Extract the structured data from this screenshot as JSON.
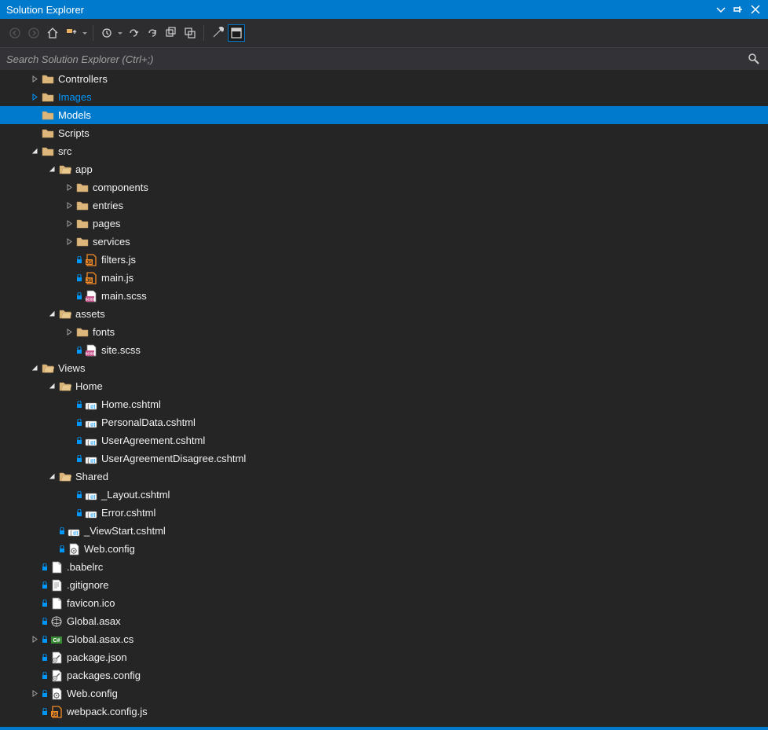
{
  "title": "Solution Explorer",
  "search": {
    "placeholder": "Search Solution Explorer (Ctrl+;)"
  },
  "toolbar": {
    "back": "back",
    "forward": "forward",
    "home": "home",
    "sync": "sync",
    "pending": "pending",
    "undo": "undo",
    "refresh": "refresh",
    "collapse": "collapse-all",
    "showall": "show-all",
    "properties": "properties",
    "preview": "preview"
  },
  "tree": [
    {
      "depth": 1,
      "arrow": "closed",
      "icon": "folder",
      "label": "Controllers"
    },
    {
      "depth": 1,
      "arrow": "closed",
      "icon": "folder",
      "label": "Images",
      "active": true
    },
    {
      "depth": 1,
      "arrow": "none",
      "icon": "folder",
      "label": "Models",
      "selected": true
    },
    {
      "depth": 1,
      "arrow": "none",
      "icon": "folder",
      "label": "Scripts"
    },
    {
      "depth": 1,
      "arrow": "open",
      "icon": "folder",
      "label": "src"
    },
    {
      "depth": 2,
      "arrow": "open",
      "icon": "folder-o",
      "label": "app"
    },
    {
      "depth": 3,
      "arrow": "closed",
      "icon": "folder",
      "label": "components"
    },
    {
      "depth": 3,
      "arrow": "closed",
      "icon": "folder",
      "label": "entries"
    },
    {
      "depth": 3,
      "arrow": "closed",
      "icon": "folder",
      "label": "pages"
    },
    {
      "depth": 3,
      "arrow": "closed",
      "icon": "folder",
      "label": "services"
    },
    {
      "depth": 3,
      "arrow": "none",
      "icon": "js",
      "label": "filters.js",
      "lock": true
    },
    {
      "depth": 3,
      "arrow": "none",
      "icon": "js",
      "label": "main.js",
      "lock": true
    },
    {
      "depth": 3,
      "arrow": "none",
      "icon": "scss",
      "label": "main.scss",
      "lock": true
    },
    {
      "depth": 2,
      "arrow": "open",
      "icon": "folder-o",
      "label": "assets"
    },
    {
      "depth": 3,
      "arrow": "closed",
      "icon": "folder",
      "label": "fonts"
    },
    {
      "depth": 3,
      "arrow": "none",
      "icon": "scss",
      "label": "site.scss",
      "lock": true
    },
    {
      "depth": 1,
      "arrow": "open",
      "icon": "folder-o",
      "label": "Views"
    },
    {
      "depth": 2,
      "arrow": "open",
      "icon": "folder-o",
      "label": "Home"
    },
    {
      "depth": 3,
      "arrow": "none",
      "icon": "cshtml",
      "label": "Home.cshtml",
      "lock": true
    },
    {
      "depth": 3,
      "arrow": "none",
      "icon": "cshtml",
      "label": "PersonalData.cshtml",
      "lock": true
    },
    {
      "depth": 3,
      "arrow": "none",
      "icon": "cshtml",
      "label": "UserAgreement.cshtml",
      "lock": true
    },
    {
      "depth": 3,
      "arrow": "none",
      "icon": "cshtml",
      "label": "UserAgreementDisagree.cshtml",
      "lock": true
    },
    {
      "depth": 2,
      "arrow": "open",
      "icon": "folder-o",
      "label": "Shared"
    },
    {
      "depth": 3,
      "arrow": "none",
      "icon": "cshtml",
      "label": "_Layout.cshtml",
      "lock": true
    },
    {
      "depth": 3,
      "arrow": "none",
      "icon": "cshtml",
      "label": "Error.cshtml",
      "lock": true
    },
    {
      "depth": 2,
      "arrow": "none",
      "icon": "cshtml",
      "label": "_ViewStart.cshtml",
      "lock": true
    },
    {
      "depth": 2,
      "arrow": "none",
      "icon": "config",
      "label": "Web.config",
      "lock": true
    },
    {
      "depth": 1,
      "arrow": "none",
      "icon": "file",
      "label": ".babelrc",
      "lock": true
    },
    {
      "depth": 1,
      "arrow": "none",
      "icon": "text",
      "label": ".gitignore",
      "lock": true
    },
    {
      "depth": 1,
      "arrow": "none",
      "icon": "file",
      "label": "favicon.ico",
      "lock": true
    },
    {
      "depth": 1,
      "arrow": "none",
      "icon": "asax",
      "label": "Global.asax",
      "lock": true
    },
    {
      "depth": 1,
      "arrow": "closed",
      "icon": "cs",
      "label": "Global.asax.cs",
      "lock": true
    },
    {
      "depth": 1,
      "arrow": "none",
      "icon": "json",
      "label": "package.json",
      "lock": true
    },
    {
      "depth": 1,
      "arrow": "none",
      "icon": "json",
      "label": "packages.config",
      "lock": true
    },
    {
      "depth": 1,
      "arrow": "closed",
      "icon": "config",
      "label": "Web.config",
      "lock": true
    },
    {
      "depth": 1,
      "arrow": "none",
      "icon": "js",
      "label": "webpack.config.js",
      "lock": true
    }
  ]
}
